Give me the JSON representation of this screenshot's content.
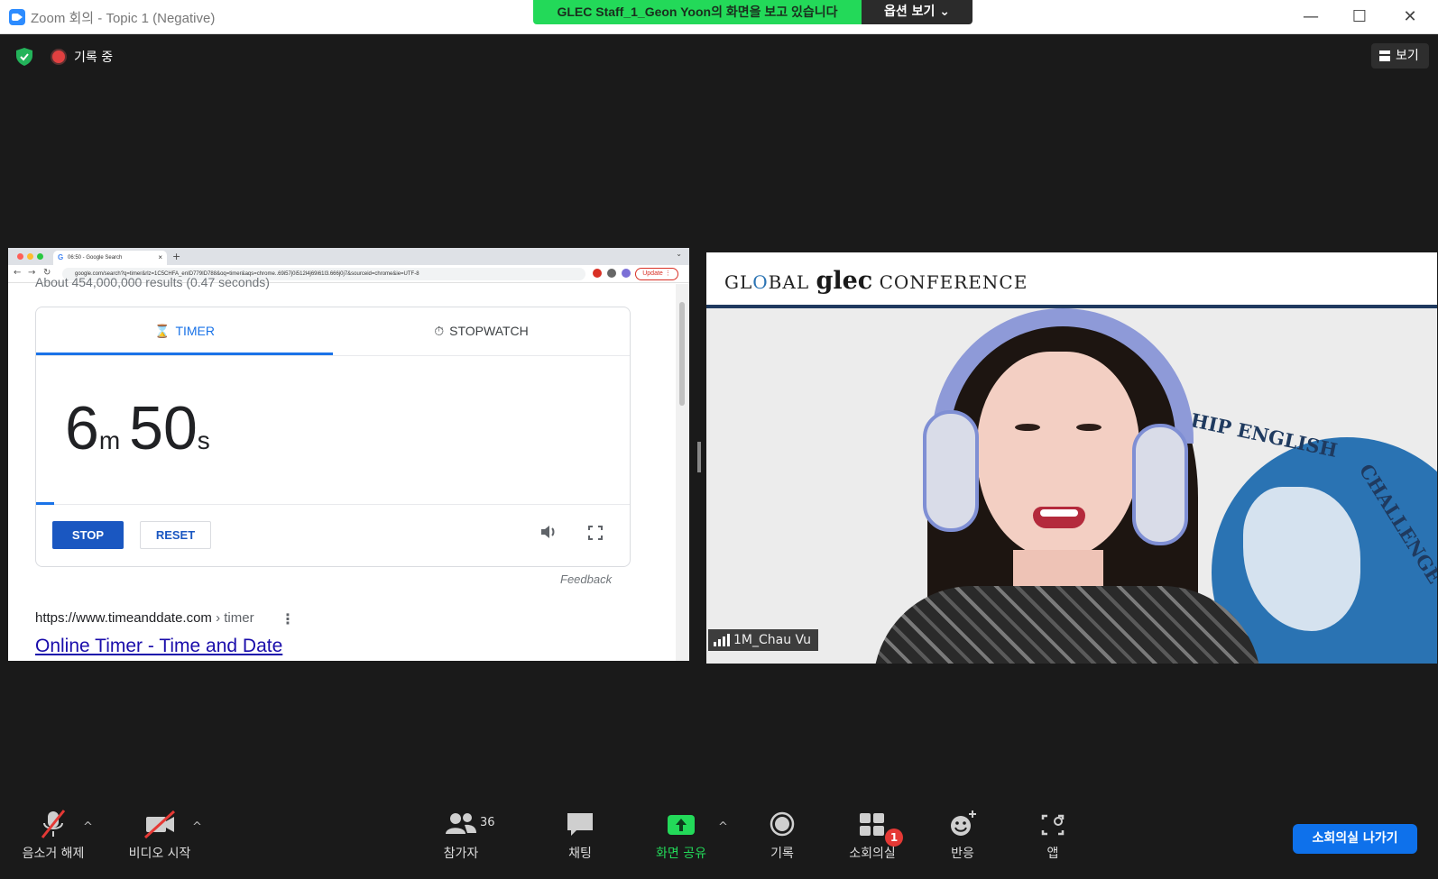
{
  "window": {
    "title": "Zoom 회의 - Topic 1 (Negative)",
    "minimize": "—",
    "maximize": "☐",
    "close": "✕"
  },
  "share_banner": {
    "text": "GLEC Staff_1_Geon Yoon의 화면을 보고 있습니다",
    "options_label": "옵션 보기 ⌄"
  },
  "top_bar": {
    "recording_label": "기록 중",
    "view_label": "보기"
  },
  "shared_screen": {
    "browser": {
      "tab_title": "06:50 - Google Search",
      "tab_favicon": "G",
      "tab_close": "×",
      "new_tab": "+",
      "tab_caret": "⌄",
      "back": "←",
      "forward": "→",
      "reload": "↻",
      "url": "google.com/search?q=timer&rlz=1C5CHFA_enID779ID788&oq=timer&aqs=chrome..69i57j0i512l4j69i61l3.666j0j7&sourceid=chrome&ie=UTF-8",
      "update_label": "Update ⋮"
    },
    "results_count_cut": "About 454,000,000 results (0.47 seconds)",
    "timer": {
      "tab_timer": "TIMER",
      "tab_stopwatch": "STOPWATCH",
      "minutes": "6",
      "minutes_unit": "m",
      "seconds": "50",
      "seconds_unit": "s",
      "stop_label": "STOP",
      "reset_label": "RESET",
      "progress": 0.03
    },
    "feedback": "Feedback",
    "result_url_host": "https://www.timeanddate.com",
    "result_url_path": " › timer",
    "result_title": "Online Timer - Time and Date"
  },
  "video": {
    "conference_prefix": "GL",
    "conference_globe_o": "O",
    "conference_mid": "BAL ",
    "conference_glec": "glec",
    "conference_suffix": " CONFERENCE",
    "arc_text_1": "SHIP ENGLISH",
    "arc_text_2": "CHALLENGE",
    "participant_name": "1M_Chau Vu"
  },
  "toolbar": {
    "mute_label": "음소거 해제",
    "video_label": "비디오 시작",
    "participants_label": "참가자",
    "participants_count": "36",
    "chat_label": "채팅",
    "share_label": "화면 공유",
    "record_label": "기록",
    "breakout_label": "소회의실",
    "breakout_badge": "1",
    "reactions_label": "반응",
    "apps_label": "앱",
    "leave_breakout_label": "소회의실 나가기",
    "caret": "^"
  },
  "colors": {
    "banner_green": "#23d959",
    "zoom_blue": "#0e71eb",
    "google_blue": "#1a73e8",
    "toolbar_bg": "#1a1a1a"
  }
}
